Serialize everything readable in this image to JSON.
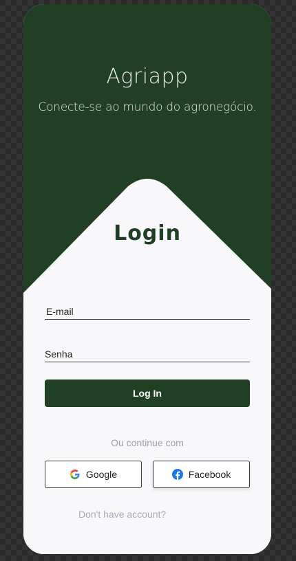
{
  "app": {
    "title": "Agriapp",
    "subtitle": "Conecte-se ao mundo do agronegócio."
  },
  "login": {
    "title": "Login",
    "email_placeholder": "E-mail",
    "password_placeholder": "Senha",
    "submit_label": "Log In"
  },
  "social": {
    "divider_text": "Ou continue com",
    "google_label": "Google",
    "facebook_label": "Facebook"
  },
  "signup": {
    "prompt": "Don't have account?"
  },
  "colors": {
    "primary": "#203f25",
    "card": "#f8f8fb",
    "muted_text": "#9aa0aa",
    "facebook_blue": "#1877f2"
  },
  "icons": [
    "google-icon",
    "facebook-icon"
  ]
}
